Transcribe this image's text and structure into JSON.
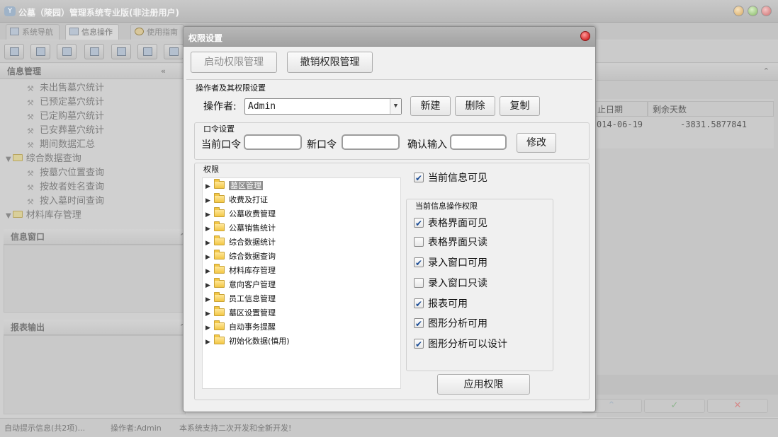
{
  "app": {
    "title": "公墓（陵园）管理系统专业版(非注册用户)",
    "logo": "Y"
  },
  "main_tabs": [
    {
      "label": "系统导航"
    },
    {
      "label": "信息操作"
    },
    {
      "label": "使用指南"
    }
  ],
  "left_panel": {
    "info_title": "信息管理",
    "items": [
      {
        "label": "未出售墓穴统计",
        "kind": "leaf"
      },
      {
        "label": "已预定墓穴统计",
        "kind": "leaf"
      },
      {
        "label": "已定购墓穴统计",
        "kind": "leaf"
      },
      {
        "label": "已安葬墓穴统计",
        "kind": "leaf"
      },
      {
        "label": "期间数据汇总",
        "kind": "leaf"
      },
      {
        "label": "综合数据查询",
        "kind": "folder"
      },
      {
        "label": "按墓穴位置查询",
        "kind": "leaf"
      },
      {
        "label": "按故者姓名查询",
        "kind": "leaf"
      },
      {
        "label": "按入墓时间查询",
        "kind": "leaf"
      },
      {
        "label": "材料库存管理",
        "kind": "folder"
      }
    ],
    "window_title": "信息窗口",
    "report_title": "报表输出"
  },
  "grid": {
    "col_date": "止日期",
    "col_days": "剩余天数",
    "row_date": "014-06-19",
    "row_days": "-3831.5877841"
  },
  "status_bar": {
    "hint": "自动提示信息(共2项)...",
    "operator": "操作者:Admin",
    "note": "本系统支持二次开发和全新开发!"
  },
  "dialog": {
    "title": "权限设置",
    "tab_enable": "启动权限管理",
    "tab_revoke": "撤销权限管理",
    "operator_group": "操作者及其权限设置",
    "operator_label": "操作者:",
    "operator_value": "Admin",
    "btn_new": "新建",
    "btn_delete": "删除",
    "btn_copy": "复制",
    "password_group": "口令设置",
    "current_pwd_label": "当前口令",
    "new_pwd_label": "新口令",
    "confirm_label": "确认输入",
    "btn_modify": "修改",
    "perm_group": "权限",
    "tree": [
      "墓区管理",
      "收费及打证",
      "公墓收费管理",
      "公墓销售统计",
      "综合数据统计",
      "综合数据查询",
      "材料库存管理",
      "意向客户管理",
      "员工信息管理",
      "墓区设置管理",
      "自动事务提醒",
      "初始化数据(慎用)"
    ],
    "visible_label": "当前信息可见",
    "visible_checked": true,
    "ops_group": "当前信息操作权限",
    "ops": [
      {
        "label": "表格界面可见",
        "checked": true
      },
      {
        "label": "表格界面只读",
        "checked": false
      },
      {
        "label": "录入窗口可用",
        "checked": true
      },
      {
        "label": "录入窗口只读",
        "checked": false
      },
      {
        "label": "报表可用",
        "checked": true
      },
      {
        "label": "图形分析可用",
        "checked": true
      },
      {
        "label": "图形分析可以设计",
        "checked": true
      }
    ],
    "btn_apply": "应用权限"
  }
}
